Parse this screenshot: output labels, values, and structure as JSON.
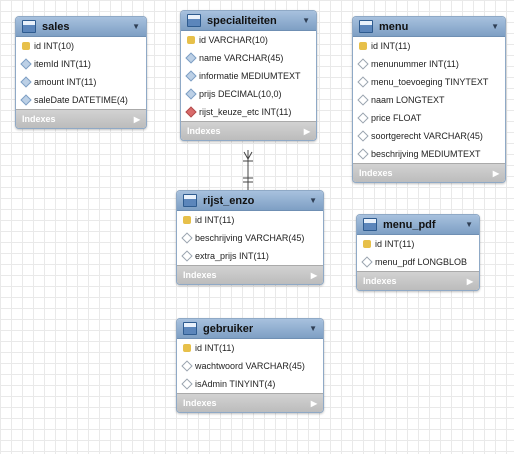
{
  "tables": {
    "sales": {
      "title": "sales",
      "columns": [
        "id INT(10)",
        "itemId INT(11)",
        "amount INT(11)",
        "saleDate DATETIME(4)"
      ],
      "indexes": "Indexes"
    },
    "specialiteiten": {
      "title": "specialiteiten",
      "columns": [
        "id VARCHAR(10)",
        "name VARCHAR(45)",
        "informatie MEDIUMTEXT",
        "prijs DECIMAL(10,0)",
        "rijst_keuze_etc INT(11)"
      ],
      "indexes": "Indexes"
    },
    "menu": {
      "title": "menu",
      "columns": [
        "id INT(11)",
        "menunummer INT(11)",
        "menu_toevoeging TINYTEXT",
        "naam LONGTEXT",
        "price FLOAT",
        "soortgerecht VARCHAR(45)",
        "beschrijving MEDIUMTEXT"
      ],
      "indexes": "Indexes"
    },
    "rijst_enzo": {
      "title": "rijst_enzo",
      "columns": [
        "id INT(11)",
        "beschrijving VARCHAR(45)",
        "extra_prijs INT(11)"
      ],
      "indexes": "Indexes"
    },
    "menu_pdf": {
      "title": "menu_pdf",
      "columns": [
        "id INT(11)",
        "menu_pdf LONGBLOB"
      ],
      "indexes": "Indexes"
    },
    "gebruiker": {
      "title": "gebruiker",
      "columns": [
        "id INT(11)",
        "wachtwoord VARCHAR(45)",
        "isAdmin TINYINT(4)"
      ],
      "indexes": "Indexes"
    }
  }
}
